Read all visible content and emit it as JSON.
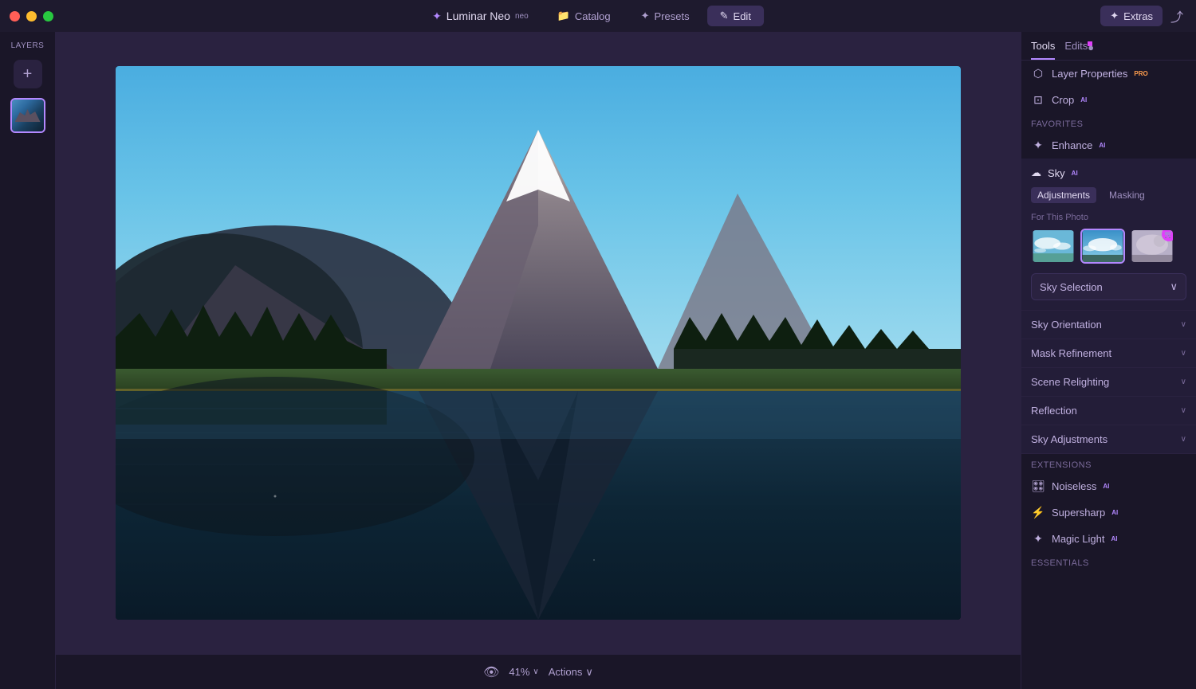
{
  "window": {
    "title": "Luminar Neo"
  },
  "titlebar": {
    "controls": {
      "close": "close",
      "minimize": "minimize",
      "maximize": "maximize"
    },
    "logo": "✦",
    "app_name": "luminar",
    "app_suffix": "neo",
    "extras_label": "Extras",
    "share_icon": "⤴"
  },
  "nav": {
    "tabs": [
      {
        "id": "catalog",
        "label": "Catalog",
        "icon": "📁",
        "active": false
      },
      {
        "id": "presets",
        "label": "Presets",
        "icon": "✦",
        "active": false
      },
      {
        "id": "edit",
        "label": "Edit",
        "icon": "✎",
        "active": true
      }
    ]
  },
  "sidebar": {
    "label": "Layers",
    "add_label": "+",
    "layers": [
      {
        "id": "layer-1",
        "thumb": "mountain-lake"
      }
    ]
  },
  "canvas": {
    "zoom": "41%"
  },
  "bottom_bar": {
    "eye_icon": "👁",
    "zoom": "41%",
    "zoom_label": "41%",
    "actions_label": "Actions",
    "chevron": "∨"
  },
  "right_panel": {
    "tabs": [
      {
        "id": "tools",
        "label": "Tools",
        "active": true
      },
      {
        "id": "edits",
        "label": "Edits",
        "active": false,
        "dot": true
      }
    ],
    "layer_properties": {
      "label": "Layer Properties",
      "badge": "PRO",
      "icon": "⬡"
    },
    "crop": {
      "label": "Crop",
      "badge": "AI",
      "icon": "⊡"
    },
    "favorites_label": "Favorites",
    "enhance": {
      "label": "Enhance",
      "badge": "AI",
      "icon": "✦"
    },
    "sky": {
      "label": "Sky",
      "badge": "AI",
      "icon": "☁",
      "active": true,
      "sub_tabs": [
        {
          "id": "adjustments",
          "label": "Adjustments",
          "active": true
        },
        {
          "id": "masking",
          "label": "Masking",
          "active": false
        }
      ],
      "for_photo_label": "For This Photo",
      "thumbs": [
        {
          "id": "sky-1",
          "type": "cloudy-blue",
          "selected": false
        },
        {
          "id": "sky-2",
          "type": "sunset-blue",
          "selected": true
        },
        {
          "id": "sky-3",
          "type": "gray-moon",
          "selected": false,
          "has_cart": true
        }
      ],
      "selection_label": "Sky Selection",
      "selection_dropdown": "Sky Selection",
      "sections": [
        {
          "id": "sky-orientation",
          "label": "Sky Orientation"
        },
        {
          "id": "mask-refinement",
          "label": "Mask Refinement"
        },
        {
          "id": "scene-relighting",
          "label": "Scene Relighting"
        },
        {
          "id": "reflection",
          "label": "Reflection"
        },
        {
          "id": "sky-adjustments",
          "label": "Sky Adjustments"
        }
      ]
    },
    "extensions_label": "Extensions",
    "extensions": [
      {
        "id": "noiseless",
        "label": "Noiseless",
        "badge": "AI",
        "icon": "🎛"
      },
      {
        "id": "supersharp",
        "label": "Supersharp",
        "badge": "AI",
        "icon": "⚡"
      },
      {
        "id": "magic-light",
        "label": "Magic Light",
        "badge": "AI",
        "icon": "✦"
      }
    ],
    "essentials_label": "Essentials"
  }
}
